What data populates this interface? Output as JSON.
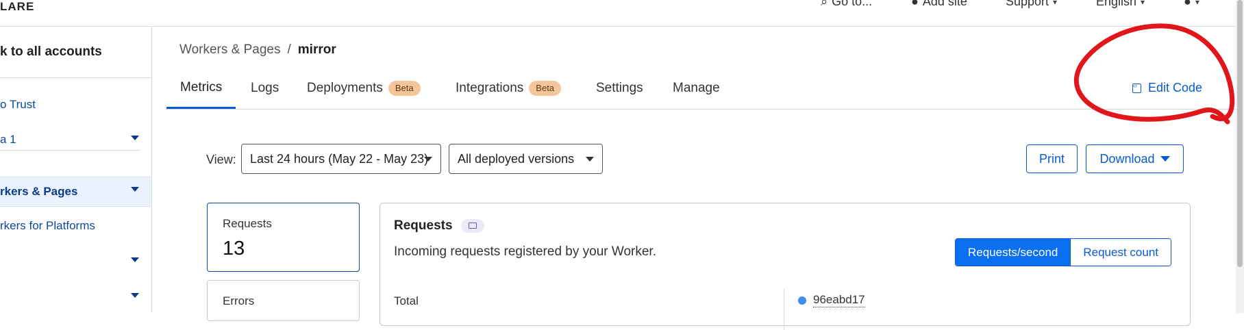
{
  "topbar": {
    "logo": "LARE",
    "goto": "Go to...",
    "add_site": "Add site",
    "support": "Support",
    "language": "English"
  },
  "sidebar": {
    "back": "k to all accounts",
    "items": [
      {
        "label": "o Trust"
      },
      {
        "label": "a 1"
      },
      {
        "label": "rkers & Pages"
      },
      {
        "label": "rkers for Platforms"
      },
      {
        "label": ""
      },
      {
        "label": ""
      }
    ]
  },
  "breadcrumb": {
    "parent": "Workers & Pages",
    "sep": "/",
    "current": "mirror"
  },
  "tabs": [
    {
      "label": "Metrics"
    },
    {
      "label": "Logs"
    },
    {
      "label": "Deployments",
      "badge": "Beta"
    },
    {
      "label": "Integrations",
      "badge": "Beta"
    },
    {
      "label": "Settings"
    },
    {
      "label": "Manage"
    }
  ],
  "edit_code": "Edit Code",
  "controls": {
    "view_label": "View:",
    "time_range": "Last 24 hours (May 22 - May 23)",
    "versions": "All deployed versions",
    "print": "Print",
    "download": "Download"
  },
  "stats": [
    {
      "label": "Requests",
      "value": "13"
    },
    {
      "label": "Errors",
      "value": ""
    }
  ],
  "panel": {
    "title": "Requests",
    "subtitle": "Incoming requests registered by your Worker.",
    "seg_on": "Requests/second",
    "seg_off": "Request count",
    "total_label": "Total",
    "version_id": "96eabd17"
  },
  "colors": {
    "accent": "#0a5ad4",
    "annotation": "#e0161b",
    "beta": "#f6c69a"
  }
}
